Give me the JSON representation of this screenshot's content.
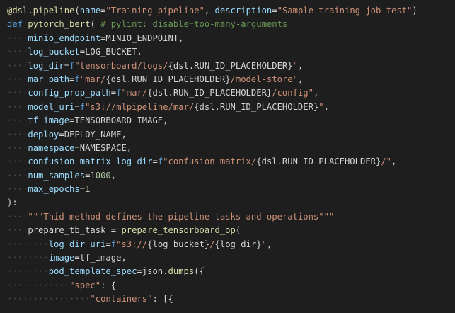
{
  "editor": {
    "colors": {
      "background": "#1e1e1e",
      "default": "#d4d4d4",
      "keyword": "#569cd6",
      "function": "#dcdcaa",
      "parameter": "#9cdcfe",
      "string": "#ce9178",
      "number": "#b5cea8",
      "comment": "#6a9955",
      "whitespace": "rgba(200,200,200,0.28)"
    },
    "lines": [
      [
        [
          "function",
          "@dsl.pipeline"
        ],
        [
          "default",
          "("
        ],
        [
          "parameter",
          "name"
        ],
        [
          "default",
          "="
        ],
        [
          "string",
          "\"Training pipeline\""
        ],
        [
          "default",
          ", "
        ],
        [
          "parameter",
          "description"
        ],
        [
          "default",
          "="
        ],
        [
          "string",
          "\"Sample training job test\""
        ],
        [
          "default",
          ")"
        ]
      ],
      [
        [
          "keyword",
          "def"
        ],
        [
          "default",
          " "
        ],
        [
          "function",
          "pytorch_bert"
        ],
        [
          "default",
          "( "
        ],
        [
          "comment",
          "# pylint: disable=too-many-arguments"
        ]
      ],
      [
        [
          "ws",
          "····"
        ],
        [
          "parameter",
          "minio_endpoint"
        ],
        [
          "default",
          "=MINIO_ENDPOINT,"
        ]
      ],
      [
        [
          "ws",
          "····"
        ],
        [
          "parameter",
          "log_bucket"
        ],
        [
          "default",
          "=LOG_BUCKET,"
        ]
      ],
      [
        [
          "ws",
          "····"
        ],
        [
          "parameter",
          "log_dir"
        ],
        [
          "default",
          "="
        ],
        [
          "keyword",
          "f"
        ],
        [
          "string",
          "\"tensorboard/logs/"
        ],
        [
          "default",
          "{dsl.RUN_ID_PLACEHOLDER}"
        ],
        [
          "string",
          "\""
        ],
        [
          "default",
          ","
        ]
      ],
      [
        [
          "ws",
          "····"
        ],
        [
          "parameter",
          "mar_path"
        ],
        [
          "default",
          "="
        ],
        [
          "keyword",
          "f"
        ],
        [
          "string",
          "\"mar/"
        ],
        [
          "default",
          "{dsl.RUN_ID_PLACEHOLDER}"
        ],
        [
          "string",
          "/model-store\""
        ],
        [
          "default",
          ","
        ]
      ],
      [
        [
          "ws",
          "····"
        ],
        [
          "parameter",
          "config_prop_path"
        ],
        [
          "default",
          "="
        ],
        [
          "keyword",
          "f"
        ],
        [
          "string",
          "\"mar/"
        ],
        [
          "default",
          "{dsl.RUN_ID_PLACEHOLDER}"
        ],
        [
          "string",
          "/config\""
        ],
        [
          "default",
          ","
        ]
      ],
      [
        [
          "ws",
          "····"
        ],
        [
          "parameter",
          "model_uri"
        ],
        [
          "default",
          "="
        ],
        [
          "keyword",
          "f"
        ],
        [
          "string",
          "\"s3://mlpipeline/mar/"
        ],
        [
          "default",
          "{dsl.RUN_ID_PLACEHOLDER}"
        ],
        [
          "string",
          "\""
        ],
        [
          "default",
          ","
        ]
      ],
      [
        [
          "ws",
          "····"
        ],
        [
          "parameter",
          "tf_image"
        ],
        [
          "default",
          "=TENSORBOARD_IMAGE,"
        ]
      ],
      [
        [
          "ws",
          "····"
        ],
        [
          "parameter",
          "deploy"
        ],
        [
          "default",
          "=DEPLOY_NAME,"
        ]
      ],
      [
        [
          "ws",
          "····"
        ],
        [
          "parameter",
          "namespace"
        ],
        [
          "default",
          "=NAMESPACE,"
        ]
      ],
      [
        [
          "ws",
          "····"
        ],
        [
          "parameter",
          "confusion_matrix_log_dir"
        ],
        [
          "default",
          "="
        ],
        [
          "keyword",
          "f"
        ],
        [
          "string",
          "\"confusion_matrix/"
        ],
        [
          "default",
          "{dsl.RUN_ID_PLACEHOLDER}"
        ],
        [
          "string",
          "/\""
        ],
        [
          "default",
          ","
        ]
      ],
      [
        [
          "ws",
          "····"
        ],
        [
          "parameter",
          "num_samples"
        ],
        [
          "default",
          "="
        ],
        [
          "number",
          "1000"
        ],
        [
          "default",
          ","
        ]
      ],
      [
        [
          "ws",
          "····"
        ],
        [
          "parameter",
          "max_epochs"
        ],
        [
          "default",
          "="
        ],
        [
          "number",
          "1"
        ]
      ],
      [
        [
          "default",
          "):"
        ]
      ],
      [
        [
          "ws",
          "····"
        ],
        [
          "string",
          "\"\"\"Thid method defines the pipeline tasks and operations\"\"\""
        ]
      ],
      [
        [
          "ws",
          "····"
        ],
        [
          "default",
          "prepare_tb_task = "
        ],
        [
          "function",
          "prepare_tensorboard_op"
        ],
        [
          "default",
          "("
        ]
      ],
      [
        [
          "ws",
          "········"
        ],
        [
          "parameter",
          "log_dir_uri"
        ],
        [
          "default",
          "="
        ],
        [
          "keyword",
          "f"
        ],
        [
          "string",
          "\"s3://"
        ],
        [
          "default",
          "{log_bucket}"
        ],
        [
          "string",
          "/"
        ],
        [
          "default",
          "{log_dir}"
        ],
        [
          "string",
          "\""
        ],
        [
          "default",
          ","
        ]
      ],
      [
        [
          "ws",
          "········"
        ],
        [
          "parameter",
          "image"
        ],
        [
          "default",
          "=tf_image,"
        ]
      ],
      [
        [
          "ws",
          "········"
        ],
        [
          "parameter",
          "pod_template_spec"
        ],
        [
          "default",
          "=json."
        ],
        [
          "function",
          "dumps"
        ],
        [
          "default",
          "({"
        ]
      ],
      [
        [
          "ws",
          "············"
        ],
        [
          "string",
          "\"spec\""
        ],
        [
          "default",
          ": {"
        ]
      ],
      [
        [
          "ws",
          "················"
        ],
        [
          "string",
          "\"containers\""
        ],
        [
          "default",
          ": [{"
        ]
      ]
    ]
  }
}
